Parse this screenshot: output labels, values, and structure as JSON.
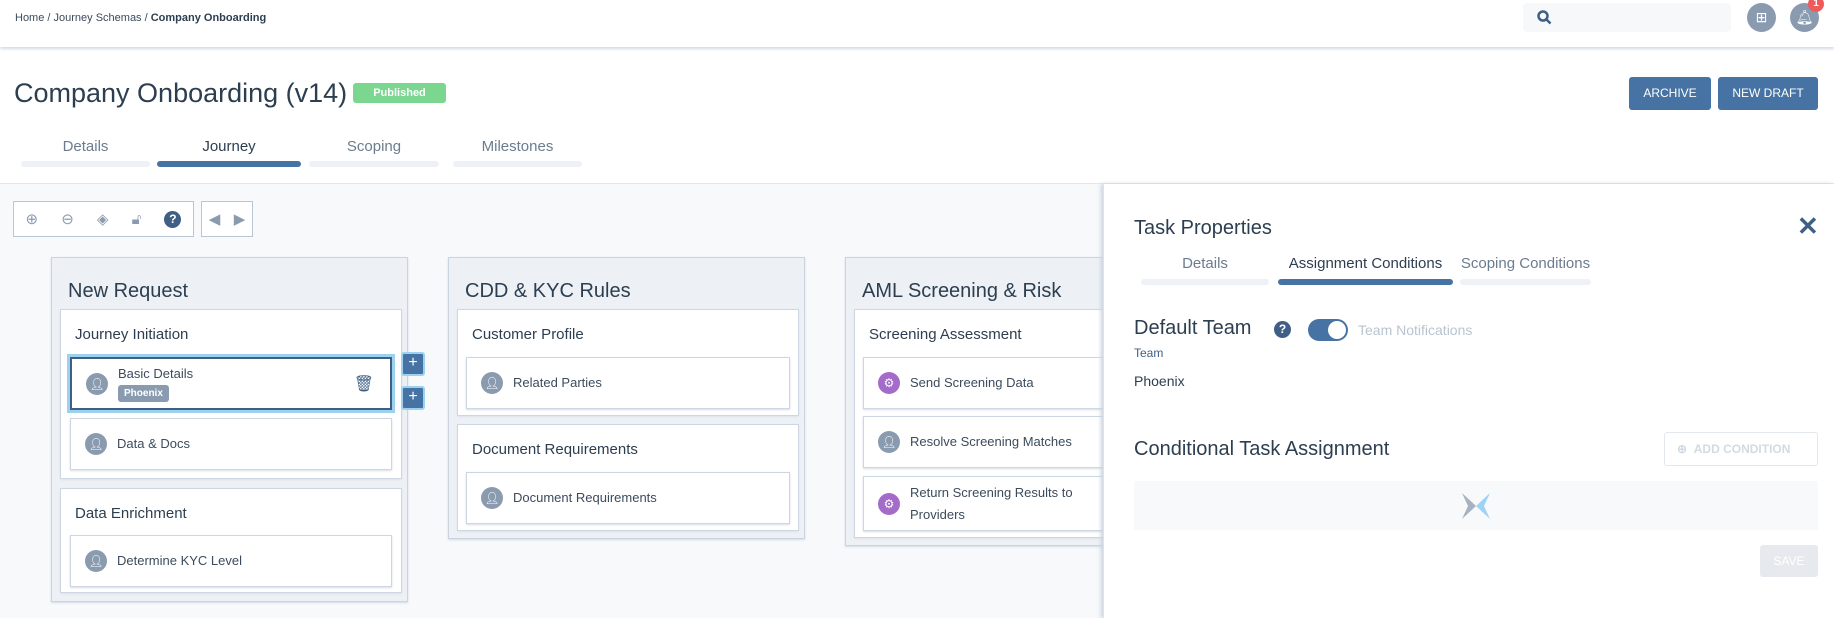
{
  "breadcrumb": {
    "home": "Home",
    "schemas": "Journey Schemas",
    "current": "Company Onboarding"
  },
  "header": {
    "search_placeholder": "",
    "notification_count": "1",
    "icons": [
      "search-icon",
      "folder-plus-icon",
      "bell-icon"
    ]
  },
  "page": {
    "title": "Company Onboarding (v14)",
    "status": "Published",
    "status_color": "#7bd68f",
    "archive_label": "ARCHIVE",
    "new_draft_label": "NEW DRAFT"
  },
  "tabs": [
    {
      "label": "Details"
    },
    {
      "label": "Journey",
      "active": true
    },
    {
      "label": "Scoping"
    },
    {
      "label": "Milestones"
    }
  ],
  "toolbar": {
    "icons": [
      "zoom-in-icon",
      "zoom-out-icon",
      "fit-icon",
      "unlock-icon",
      "help-icon",
      "prev-icon",
      "next-icon"
    ]
  },
  "columns": [
    {
      "title": "New Request",
      "sections": [
        {
          "title": "Journey Initiation",
          "tasks": [
            {
              "label": "Basic Details",
              "team": "Phoenix",
              "type": "manual"
            },
            {
              "label": "Data & Docs",
              "type": "manual"
            }
          ]
        },
        {
          "title": "Data Enrichment",
          "tasks": [
            {
              "label": "Determine KYC Level",
              "type": "manual"
            }
          ]
        }
      ]
    },
    {
      "title": "CDD & KYC Rules",
      "sections": [
        {
          "title": "Customer Profile",
          "tasks": [
            {
              "label": "Related Parties",
              "type": "manual"
            }
          ]
        },
        {
          "title": "Document Requirements",
          "tasks": [
            {
              "label": "Document Requirements",
              "type": "manual"
            }
          ]
        }
      ]
    },
    {
      "title": "AML Screening & Risk",
      "sections": [
        {
          "title": "Screening Assessment",
          "tasks": [
            {
              "label": "Send Screening Data",
              "type": "automated"
            },
            {
              "label": "Resolve Screening Matches",
              "type": "manual"
            },
            {
              "label": "Return Screening Results to Providers",
              "type": "automated"
            }
          ]
        }
      ]
    }
  ],
  "panel": {
    "title": "Task Properties",
    "tabs": [
      {
        "label": "Details"
      },
      {
        "label": "Assignment Conditions",
        "active": true
      },
      {
        "label": "Scoping Conditions"
      }
    ],
    "default_team_heading": "Default Team",
    "team_notifications_label": "Team Notifications",
    "team_notifications_on": true,
    "team_label": "Team",
    "team_value": "Phoenix",
    "conditional_heading": "Conditional Task Assignment",
    "add_condition_label": "ADD CONDITION",
    "save_label": "SAVE"
  },
  "colors": {
    "primary": "#4673a3",
    "automated": "#a46cc9",
    "manual": "#8a9bb0"
  }
}
